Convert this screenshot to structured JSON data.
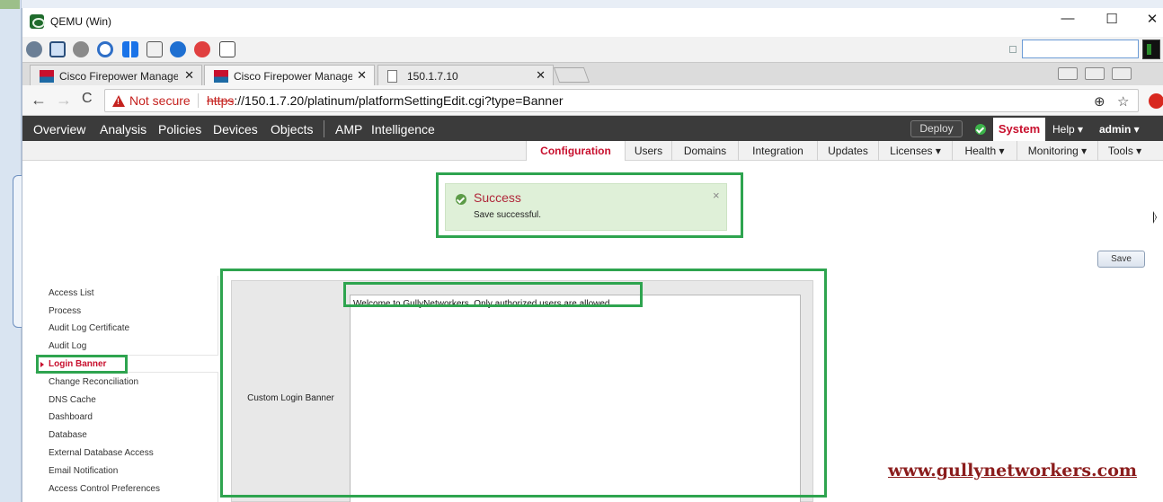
{
  "window": {
    "title": "QEMU (Win)",
    "controls": {
      "minimize": "—",
      "maximize": "☐",
      "close": "✕"
    }
  },
  "qemu_toolbar": {
    "icons": [
      "network-icon",
      "screen-icon",
      "settings-icon",
      "refresh-icon",
      "windows-icon",
      "keyboard-icon",
      "info-icon",
      "stop-icon",
      "exit-icon"
    ],
    "colors": {
      "info": "#1e6fd1",
      "stop": "#e04040",
      "windows": "#1a73e8"
    }
  },
  "browser": {
    "tabs": [
      {
        "label": "Cisco Firepower Manager",
        "close": "✕"
      },
      {
        "label": "Cisco Firepower Manager",
        "close": "✕"
      },
      {
        "label": "150.1.7.10",
        "close": "✕"
      }
    ],
    "nav": {
      "back": "←",
      "forward": "→",
      "reload": "C"
    },
    "security_label": "Not secure",
    "url_scheme": "https",
    "url_rest": "://150.1.7.20/platinum/platformSettingEdit.cgi?type=Banner",
    "omni_icons": {
      "zoom": "⊕",
      "star": "☆"
    }
  },
  "fmc_nav": {
    "items": [
      "Overview",
      "Analysis",
      "Policies",
      "Devices",
      "Objects",
      "AMP",
      "Intelligence"
    ],
    "deploy_label": "Deploy",
    "system_label": "System",
    "help_label": "Help ▾",
    "user_label": "admin ▾"
  },
  "subnav": {
    "items": [
      "Configuration",
      "Users",
      "Domains",
      "Integration",
      "Updates",
      "Licenses ▾",
      "Health ▾",
      "Monitoring ▾",
      "Tools ▾"
    ]
  },
  "alert": {
    "title": "Success",
    "message": "Save successful.",
    "close": "×",
    "colors": {
      "background": "#dff0d8",
      "title": "#b0273a"
    }
  },
  "save_button": "Save",
  "sidebar": {
    "items": [
      "Access List",
      "Process",
      "Audit Log Certificate",
      "Audit Log",
      "Login Banner",
      "Change Reconciliation",
      "DNS Cache",
      "Dashboard",
      "Database",
      "External Database Access",
      "Email Notification",
      "Access Control Preferences"
    ],
    "active": "Login Banner"
  },
  "form": {
    "label": "Custom Login Banner",
    "value": "Welcome to GullyNetworkers. Only authorized users are allowed."
  },
  "watermark": "www.gullynetworkers.com",
  "highlight_color": "#2ea44f",
  "accent_red": "#c8102e"
}
